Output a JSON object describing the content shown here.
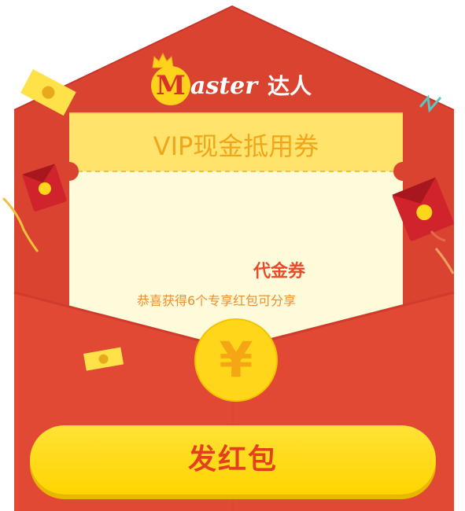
{
  "logo": {
    "mark": "M",
    "text": "aster",
    "cn": "达人"
  },
  "coupon": {
    "title": "VIP现金抵用券",
    "name": "代金券",
    "description": "恭喜获得6个专享红包可分享"
  },
  "coin": {
    "symbol": "¥"
  },
  "cta": {
    "label": "发红包"
  },
  "colors": {
    "envelope_red": "#e14934",
    "envelope_dark": "#c8352a",
    "coupon_yellow": "#ffe36b",
    "coupon_cream": "#fefbdb",
    "coin_yellow": "#ffd61a",
    "button_yellow": "#ffd400",
    "text_red": "#e44020"
  },
  "icons": [
    "crown-icon",
    "yuan-coin-icon",
    "red-packet-icon",
    "flying-bill-icon",
    "confetti-icon"
  ]
}
